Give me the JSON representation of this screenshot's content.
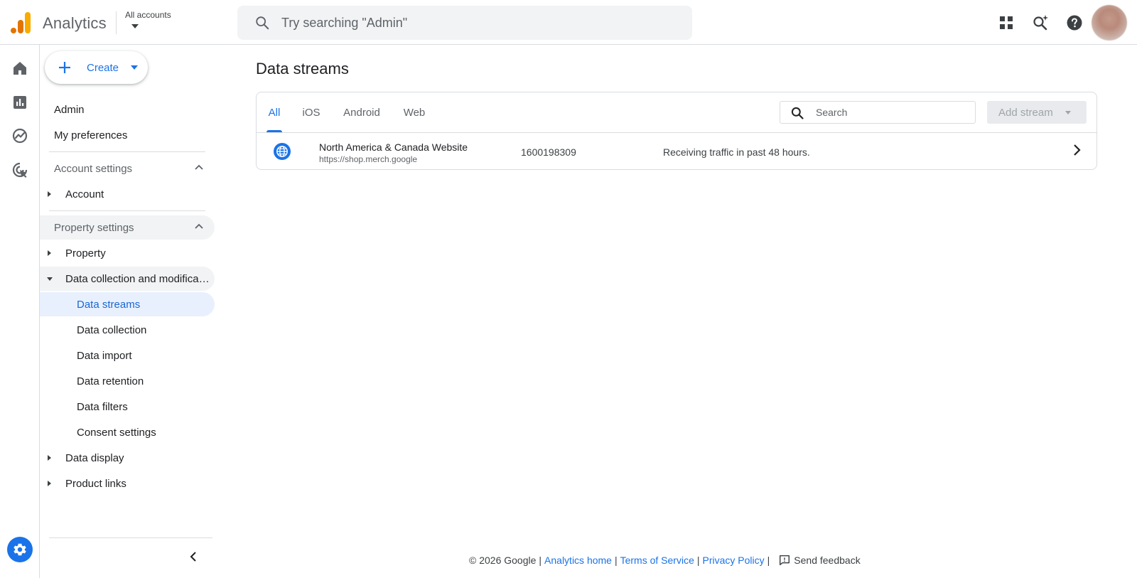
{
  "header": {
    "app_title": "Analytics",
    "account_picker_label": "All accounts",
    "search_placeholder": "Try searching \"Admin\"",
    "icons": [
      "apps-grid-icon",
      "search-spark-icon",
      "help-icon"
    ],
    "brand_colors": {
      "logo_orange": "#f9ab00",
      "logo_dark_orange": "#e37400",
      "accent": "#1a73e8"
    }
  },
  "rail": {
    "items": [
      "home-icon",
      "reports-icon",
      "explore-icon",
      "advertising-icon"
    ],
    "admin": "settings-gear-icon"
  },
  "sidenav": {
    "create_label": "Create",
    "admin": "Admin",
    "my_preferences": "My preferences",
    "account_settings": "Account settings",
    "account": "Account",
    "property_settings": "Property settings",
    "property": "Property",
    "data_collection": "Data collection and modifications",
    "data_streams": "Data streams",
    "data_collection_item": "Data collection",
    "data_import": "Data import",
    "data_retention": "Data retention",
    "data_filters": "Data filters",
    "consent_settings": "Consent settings",
    "data_display": "Data display",
    "product_links": "Product links"
  },
  "main": {
    "title": "Data streams",
    "tabs": [
      {
        "label": "All",
        "active": true
      },
      {
        "label": "iOS",
        "active": false
      },
      {
        "label": "Android",
        "active": false
      },
      {
        "label": "Web",
        "active": false
      }
    ],
    "search_placeholder": "Search",
    "add_stream_label": "Add stream",
    "streams": [
      {
        "name": "North America & Canada Website",
        "url": "https://shop.merch.google",
        "id": "1600198309",
        "status": "Receiving traffic in past 48 hours."
      }
    ]
  },
  "footer": {
    "copyright": "© 2026 Google",
    "sep": "|",
    "analytics_home": "Analytics home",
    "terms": "Terms of Service",
    "privacy": "Privacy Policy",
    "feedback": "Send feedback"
  }
}
